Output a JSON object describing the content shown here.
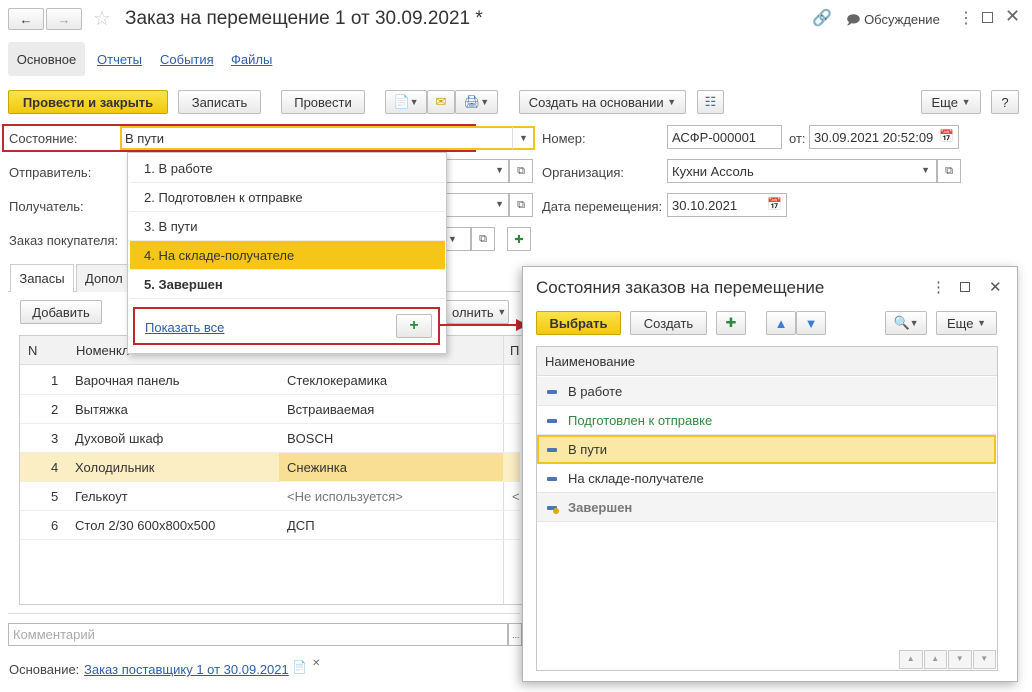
{
  "window": {
    "title": "Заказ на перемещение 1 от 30.09.2021 *",
    "discussion": "Обсуждение"
  },
  "tabs": {
    "main": "Основное",
    "reports": "Отчеты",
    "events": "События",
    "files": "Файлы"
  },
  "toolbar": {
    "post_close": "Провести и закрыть",
    "save": "Записать",
    "post": "Провести",
    "create_based": "Создать на основании",
    "more": "Еще",
    "help": "?"
  },
  "form": {
    "status_label": "Состояние:",
    "status_value": "В пути",
    "number_label": "Номер:",
    "number_value": "АСФР-000001",
    "from_label": "от:",
    "date_value": "30.09.2021 20:52:09",
    "sender_label": "Отправитель:",
    "org_label": "Организация:",
    "org_value": "Кухни Ассоль",
    "receiver_label": "Получатель:",
    "move_date_label": "Дата перемещения:",
    "move_date_value": "30.10.2021",
    "customer_order_label": "Заказ покупателя:"
  },
  "dropdown": {
    "items": [
      "1. В работе",
      "2. Подготовлен к отправке",
      "3. В пути",
      "4. На складе-получателе",
      "5. Завершен"
    ],
    "show_all": "Показать все"
  },
  "inner_tabs": {
    "stock": "Запасы",
    "extra": "Допол"
  },
  "table": {
    "add": "Добавить",
    "fill": "олнить",
    "col_n": "N",
    "col_item": "Номенкл",
    "col_p": "П",
    "rows": [
      {
        "n": "1",
        "item": "Варочная панель",
        "char": "Стеклокерамика"
      },
      {
        "n": "2",
        "item": "Вытяжка",
        "char": "Встраиваемая"
      },
      {
        "n": "3",
        "item": "Духовой шкаф",
        "char": "BOSCH"
      },
      {
        "n": "4",
        "item": "Холодильник",
        "char": "Снежинка"
      },
      {
        "n": "5",
        "item": "Гелькоут",
        "char": "<Не используется>",
        "extra": "<"
      },
      {
        "n": "6",
        "item": "Стол 2/30 600х800х500",
        "char": "ДСП"
      }
    ]
  },
  "comment_placeholder": "Комментарий",
  "basis": {
    "label": "Основание:",
    "link": "Заказ поставщику 1 от 30.09.2021"
  },
  "popup": {
    "title": "Состояния заказов на перемещение",
    "select": "Выбрать",
    "create": "Создать",
    "more": "Еще",
    "col_name": "Наименование",
    "items": [
      "В работе",
      "Подготовлен к отправке",
      "В пути",
      "На складе-получателе",
      "Завершен"
    ]
  },
  "colors": {
    "accent_yellow": "#f5d21f",
    "highlight_row": "#fbe7a6",
    "red_frame": "#c0282d",
    "green_text": "#2e8b3d"
  }
}
